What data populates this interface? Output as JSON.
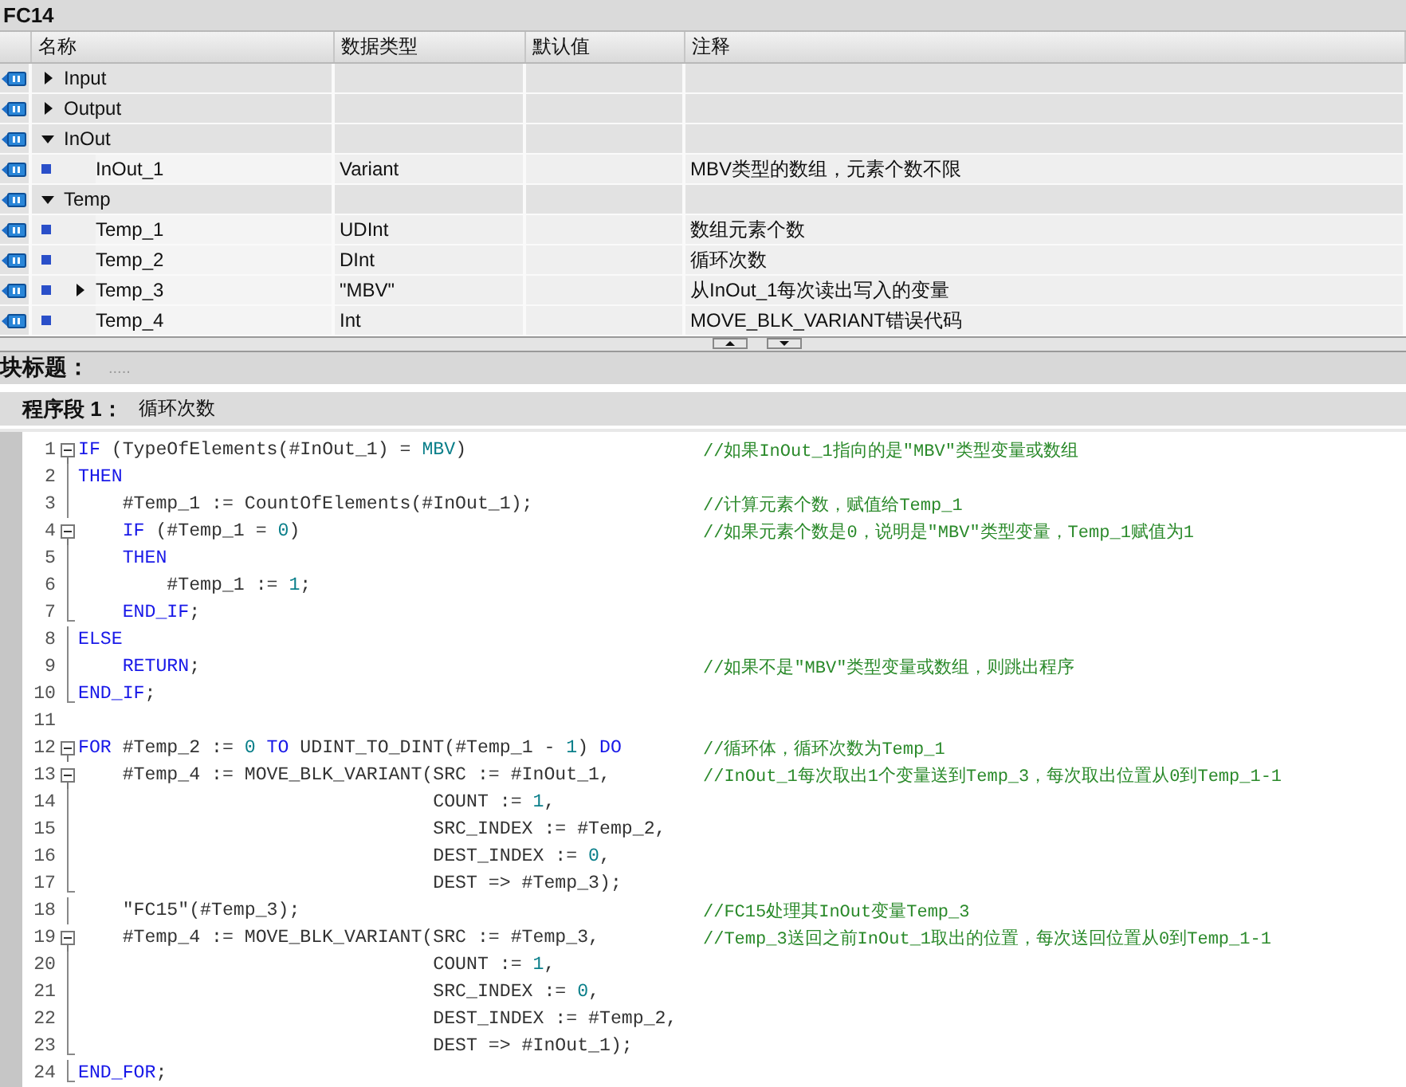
{
  "block": {
    "title": "FC14"
  },
  "interface": {
    "columns": [
      "名称",
      "数据类型",
      "默认值",
      "注释"
    ],
    "params": [
      {
        "kind": "section",
        "name": "Input",
        "expanded": false
      },
      {
        "kind": "section",
        "name": "Output",
        "expanded": false
      },
      {
        "kind": "section",
        "name": "InOut",
        "expanded": true,
        "children": [
          {
            "kind": "variable",
            "name": "InOut_1",
            "type": "Variant",
            "comment": "MBV类型的数组，元素个数不限"
          }
        ]
      },
      {
        "kind": "section",
        "name": "Temp",
        "expanded": true,
        "children": [
          {
            "kind": "variable",
            "name": "Temp_1",
            "type": "UDInt",
            "comment": "数组元素个数"
          },
          {
            "kind": "variable",
            "name": "Temp_2",
            "type": "DInt",
            "comment": "循环次数"
          },
          {
            "kind": "variable",
            "name": "Temp_3",
            "type": "\"MBV\"",
            "comment": "从InOut_1每次读出写入的变量",
            "expanded": false
          },
          {
            "kind": "variable",
            "name": "Temp_4",
            "type": "Int",
            "comment": "MOVE_BLK_VARIANT错误代码"
          }
        ]
      }
    ]
  },
  "block_title": {
    "label": "块标题：",
    "placeholder": "....."
  },
  "network": {
    "label": "程序段 1：",
    "title": "循环次数"
  },
  "code": [
    {
      "number": "1",
      "collapsible": true,
      "in_block": true,
      "block_end": false,
      "segments": [
        {
          "kind": "keyword",
          "text": "IF"
        },
        {
          "kind": "plain",
          "text": " (TypeOfElements(#InOut_1) = "
        },
        {
          "kind": "constant",
          "text": "MBV"
        },
        {
          "kind": "plain",
          "text": ")"
        }
      ],
      "comment": "//如果InOut_1指向的是\"MBV\"类型变量或数组"
    },
    {
      "number": "2",
      "collapsible": false,
      "in_block": true,
      "block_end": false,
      "segments": [
        {
          "kind": "keyword",
          "text": "THEN"
        }
      ]
    },
    {
      "number": "3",
      "collapsible": false,
      "in_block": true,
      "block_end": false,
      "segments": [
        {
          "kind": "plain",
          "text": "    #Temp_1 := CountOfElements(#InOut_1);"
        }
      ],
      "comment": "//计算元素个数，赋值给Temp_1"
    },
    {
      "number": "4",
      "collapsible": true,
      "in_block": true,
      "block_end": false,
      "segments": [
        {
          "kind": "keyword",
          "text": "    IF"
        },
        {
          "kind": "plain",
          "text": " (#Temp_1 = "
        },
        {
          "kind": "constant",
          "text": "0"
        },
        {
          "kind": "plain",
          "text": ")"
        }
      ],
      "comment": "//如果元素个数是0，说明是\"MBV\"类型变量，Temp_1赋值为1"
    },
    {
      "number": "5",
      "collapsible": false,
      "in_block": true,
      "block_end": false,
      "segments": [
        {
          "kind": "keyword",
          "text": "    THEN"
        }
      ]
    },
    {
      "number": "6",
      "collapsible": false,
      "in_block": true,
      "block_end": false,
      "segments": [
        {
          "kind": "plain",
          "text": "        #Temp_1 := "
        },
        {
          "kind": "constant",
          "text": "1"
        },
        {
          "kind": "plain",
          "text": ";"
        }
      ]
    },
    {
      "number": "7",
      "collapsible": false,
      "in_block": true,
      "block_end": true,
      "segments": [
        {
          "kind": "keyword",
          "text": "    END_IF"
        },
        {
          "kind": "plain",
          "text": ";"
        }
      ]
    },
    {
      "number": "8",
      "collapsible": false,
      "in_block": true,
      "block_end": false,
      "segments": [
        {
          "kind": "keyword",
          "text": "ELSE"
        }
      ]
    },
    {
      "number": "9",
      "collapsible": false,
      "in_block": true,
      "block_end": false,
      "segments": [
        {
          "kind": "keyword",
          "text": "    RETURN"
        },
        {
          "kind": "plain",
          "text": ";"
        }
      ],
      "comment": "//如果不是\"MBV\"类型变量或数组，则跳出程序"
    },
    {
      "number": "10",
      "collapsible": false,
      "in_block": true,
      "block_end": true,
      "segments": [
        {
          "kind": "keyword",
          "text": "END_IF"
        },
        {
          "kind": "plain",
          "text": ";"
        }
      ]
    },
    {
      "number": "11"
    },
    {
      "number": "12",
      "collapsible": true,
      "in_block": true,
      "block_end": false,
      "segments": [
        {
          "kind": "keyword",
          "text": "FOR"
        },
        {
          "kind": "plain",
          "text": " #Temp_2 := "
        },
        {
          "kind": "constant",
          "text": "0"
        },
        {
          "kind": "keyword",
          "text": " TO"
        },
        {
          "kind": "plain",
          "text": " UDINT_TO_DINT(#Temp_1 - "
        },
        {
          "kind": "constant",
          "text": "1"
        },
        {
          "kind": "plain",
          "text": ") "
        },
        {
          "kind": "keyword",
          "text": "DO"
        }
      ],
      "comment": "//循环体，循环次数为Temp_1"
    },
    {
      "number": "13",
      "collapsible": true,
      "in_block": true,
      "block_end": false,
      "segments": [
        {
          "kind": "plain",
          "text": "    #Temp_4 := MOVE_BLK_VARIANT(SRC := #InOut_1,"
        }
      ],
      "comment": "//InOut_1每次取出1个变量送到Temp_3，每次取出位置从0到Temp_1-1"
    },
    {
      "number": "14",
      "collapsible": false,
      "in_block": true,
      "block_end": false,
      "segments": [
        {
          "kind": "plain",
          "text": "                                COUNT := "
        },
        {
          "kind": "constant",
          "text": "1"
        },
        {
          "kind": "plain",
          "text": ","
        }
      ]
    },
    {
      "number": "15",
      "collapsible": false,
      "in_block": true,
      "block_end": false,
      "segments": [
        {
          "kind": "plain",
          "text": "                                SRC_INDEX := #Temp_2,"
        }
      ]
    },
    {
      "number": "16",
      "collapsible": false,
      "in_block": true,
      "block_end": false,
      "segments": [
        {
          "kind": "plain",
          "text": "                                DEST_INDEX := "
        },
        {
          "kind": "constant",
          "text": "0"
        },
        {
          "kind": "plain",
          "text": ","
        }
      ]
    },
    {
      "number": "17",
      "collapsible": false,
      "in_block": true,
      "block_end": true,
      "segments": [
        {
          "kind": "plain",
          "text": "                                DEST => #Temp_3);"
        }
      ]
    },
    {
      "number": "18",
      "collapsible": false,
      "in_block": true,
      "block_end": false,
      "segments": [
        {
          "kind": "plain",
          "text": "    \"FC15\"(#Temp_3);"
        }
      ],
      "comment": "//FC15处理其InOut变量Temp_3"
    },
    {
      "number": "19",
      "collapsible": true,
      "in_block": true,
      "block_end": false,
      "segments": [
        {
          "kind": "plain",
          "text": "    #Temp_4 := MOVE_BLK_VARIANT(SRC := #Temp_3,"
        }
      ],
      "comment": "//Temp_3送回之前InOut_1取出的位置，每次送回位置从0到Temp_1-1"
    },
    {
      "number": "20",
      "collapsible": false,
      "in_block": true,
      "block_end": false,
      "segments": [
        {
          "kind": "plain",
          "text": "                                COUNT := "
        },
        {
          "kind": "constant",
          "text": "1"
        },
        {
          "kind": "plain",
          "text": ","
        }
      ]
    },
    {
      "number": "21",
      "collapsible": false,
      "in_block": true,
      "block_end": false,
      "segments": [
        {
          "kind": "plain",
          "text": "                                SRC_INDEX := "
        },
        {
          "kind": "constant",
          "text": "0"
        },
        {
          "kind": "plain",
          "text": ","
        }
      ]
    },
    {
      "number": "22",
      "collapsible": false,
      "in_block": true,
      "block_end": false,
      "segments": [
        {
          "kind": "plain",
          "text": "                                DEST_INDEX := #Temp_2,"
        }
      ]
    },
    {
      "number": "23",
      "collapsible": false,
      "in_block": true,
      "block_end": true,
      "segments": [
        {
          "kind": "plain",
          "text": "                                DEST => #InOut_1);"
        }
      ]
    },
    {
      "number": "24",
      "collapsible": false,
      "in_block": true,
      "block_end": true,
      "segments": [
        {
          "kind": "keyword",
          "text": "END_FOR"
        },
        {
          "kind": "plain",
          "text": ";"
        }
      ]
    }
  ]
}
